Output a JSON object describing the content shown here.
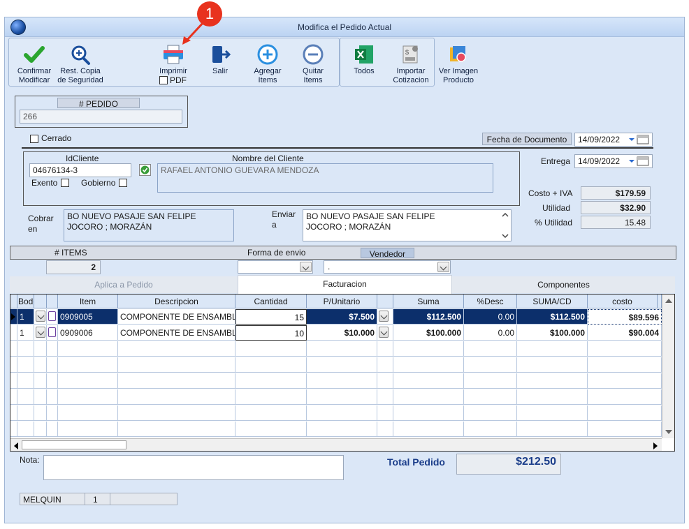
{
  "window": {
    "title": "Modifica el Pedido Actual"
  },
  "callout": {
    "number": "1"
  },
  "toolbar": {
    "confirm": [
      "Confirmar",
      "Modificar"
    ],
    "backup": [
      "Rest. Copia",
      "de Seguridad"
    ],
    "print": "Imprimir",
    "pdf": "PDF",
    "exit": "Salir",
    "add": [
      "Agregar",
      "Items"
    ],
    "remove": [
      "Quitar",
      "Items"
    ],
    "excel": "Todos",
    "import": [
      "Importar",
      "Cotizacion"
    ],
    "image": [
      "Ver Imagen",
      "Producto"
    ]
  },
  "order": {
    "label": "# PEDIDO",
    "value": "266",
    "closed_label": "Cerrado"
  },
  "dates": {
    "doc_label": "Fecha de  Documento",
    "doc_value": "14/09/2022",
    "delivery_label": "Entrega",
    "delivery_value": "14/09/2022"
  },
  "client": {
    "id_label": "IdCliente",
    "id_value": "04676134-3",
    "name_label": "Nombre del Cliente",
    "name_value": "RAFAEL ANTONIO GUEVARA MENDOZA",
    "exempt_label": "Exento",
    "gov_label": "Gobierno"
  },
  "totals_side": {
    "cost_label": "Costo + IVA",
    "cost_value": "$179.59",
    "profit_label": "Utilidad",
    "profit_value": "$32.90",
    "pct_label": "% Utilidad",
    "pct_value": "15.48"
  },
  "address": {
    "bill_label": [
      "Cobrar",
      "en"
    ],
    "bill_value": [
      "BO NUEVO PASAJE SAN FELIPE",
      "JOCORO ; MORAZÁN"
    ],
    "ship_label": [
      "Enviar",
      "a"
    ],
    "ship_value": [
      "BO NUEVO PASAJE SAN FELIPE",
      "JOCORO ; MORAZÁN"
    ]
  },
  "info_bar": {
    "items_label": "# ITEMS",
    "items_value": "2",
    "shipping_label": "Forma de envio",
    "seller_label": "Vendedor",
    "seller_value": "."
  },
  "tabs": [
    "Aplica a Pedido",
    "Facturacion",
    "Componentes"
  ],
  "grid": {
    "columns": [
      "Bodega",
      "Item",
      "Descripcion",
      "Cantidad",
      "P/Unitario",
      "Suma",
      "%Desc",
      "SUMA/CD",
      "costo"
    ],
    "rows": [
      {
        "bodega": "1",
        "item": "0909005",
        "desc": "COMPONENTE DE ENSAMBLAJE",
        "qty": "15",
        "price": "$7.500",
        "sum": "$112.500",
        "disc": "0.00",
        "sumcd": "$112.500",
        "cost": "$89.596"
      },
      {
        "bodega": "1",
        "item": "0909006",
        "desc": "COMPONENTE DE ENSAMBLAJE",
        "qty": "10",
        "price": "$10.000",
        "sum": "$100.000",
        "disc": "0.00",
        "sumcd": "$100.000",
        "cost": "$90.004"
      }
    ]
  },
  "footer": {
    "note_label": "Nota:",
    "total_label": "Total Pedido",
    "total_value": "$212.50",
    "user": "MELQUIN",
    "user_num": "1"
  },
  "colors": {
    "selected_row": "#0c2f6b",
    "callout": "#e8321e",
    "window_bg": "#dbe7f7"
  }
}
